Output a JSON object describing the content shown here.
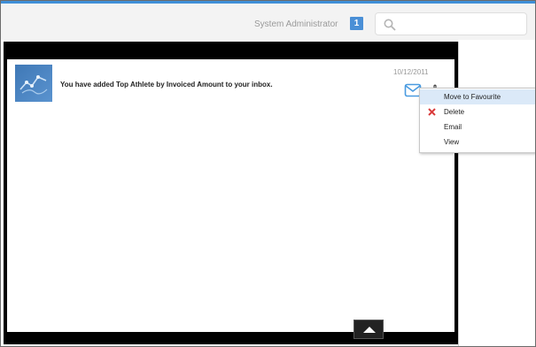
{
  "header": {
    "user_name": "System Administrator",
    "notification_count": "1",
    "search_placeholder": ""
  },
  "notification": {
    "message": "You have added Top Athlete by Invoiced Amount to your inbox.",
    "date": "10/12/2011",
    "thumbnail_icon": "report-chart-icon",
    "action_icon": "envelope-icon"
  },
  "context_menu": {
    "items": [
      {
        "label": "Move to Favourite",
        "highlighted": true
      },
      {
        "label": "Delete",
        "icon": "delete-x-icon"
      },
      {
        "label": "Email"
      },
      {
        "label": "View"
      }
    ]
  },
  "colors": {
    "accent": "#3f8fd8",
    "badge": "#4a8fd6",
    "highlight": "#dbe9f8",
    "delete": "#d93b3b"
  },
  "icons": {
    "search": "search-icon",
    "scroll_top": "arrow-up-icon",
    "cursor": "hand-cursor-icon"
  }
}
